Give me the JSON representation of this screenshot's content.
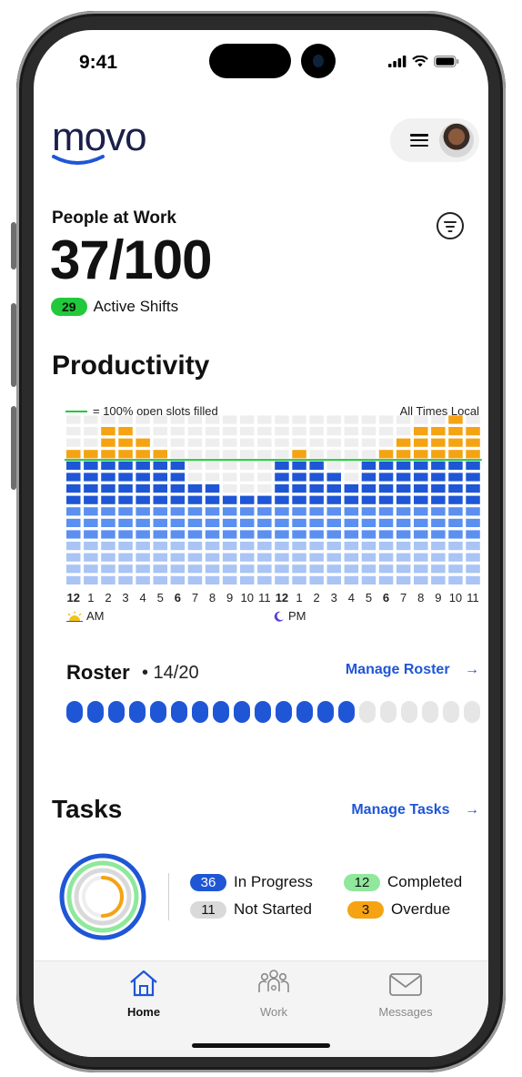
{
  "status_bar": {
    "time": "9:41"
  },
  "header": {
    "logo_text": "movo",
    "brand_color": "#1f56d6",
    "menu_icon": "hamburger-icon",
    "avatar": "user-avatar"
  },
  "people_at_work": {
    "label": "People at Work",
    "value": "37/100",
    "active_shifts_count": "29",
    "active_shifts_label": "Active Shifts",
    "filter_icon": "filter-icon"
  },
  "productivity": {
    "title": "Productivity",
    "legend_label": "= 100% open slots filled",
    "time_note": "All Times Local",
    "am_label": "AM",
    "pm_label": "PM"
  },
  "chart_data": {
    "type": "bar",
    "categories": [
      "12",
      "1",
      "2",
      "3",
      "4",
      "5",
      "6",
      "7",
      "8",
      "9",
      "10",
      "11",
      "12",
      "1",
      "2",
      "3",
      "4",
      "5",
      "6",
      "7",
      "8",
      "9",
      "10",
      "11"
    ],
    "bold_categories": [
      0,
      6,
      12,
      18
    ],
    "values": [
      12,
      12,
      14,
      14,
      13,
      12,
      11,
      9,
      9,
      8,
      8,
      8,
      11,
      12,
      11,
      10,
      9,
      11,
      12,
      13,
      14,
      14,
      15,
      14
    ],
    "capacity_line": 11,
    "ylim": [
      0,
      15
    ],
    "colors": {
      "over": "#f5a313",
      "filled": "#1f56d6",
      "mid": "#5b8ff0",
      "light": "#a9c4f5",
      "empty": "#eeeeee",
      "line": "#1ec93a"
    }
  },
  "roster": {
    "title": "Roster",
    "count": "• 14/20",
    "filled": 14,
    "total": 20,
    "manage_label": "Manage Roster",
    "arrow": "→"
  },
  "tasks": {
    "title": "Tasks",
    "manage_label": "Manage Tasks",
    "arrow": "→",
    "stats": [
      {
        "count": "36",
        "label": "In Progress",
        "color": "#1f56d6",
        "text_color": "#ffffff"
      },
      {
        "count": "12",
        "label": "Completed",
        "color": "#8fe89b",
        "text_color": "#111111"
      },
      {
        "count": "11",
        "label": "Not Started",
        "color": "#d9d9d9",
        "text_color": "#111111"
      },
      {
        "count": "3",
        "label": "Overdue",
        "color": "#f5a313",
        "text_color": "#111111"
      }
    ]
  },
  "tabs": [
    {
      "label": "Home",
      "icon": "home-icon",
      "active": true
    },
    {
      "label": "Work",
      "icon": "people-icon",
      "active": false
    },
    {
      "label": "Messages",
      "icon": "mail-icon",
      "active": false
    }
  ]
}
